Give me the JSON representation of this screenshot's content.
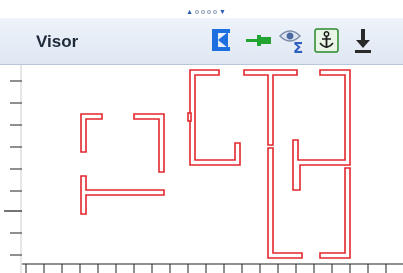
{
  "panel": {
    "title": "Visor"
  },
  "toolbar": {
    "buttons": [
      {
        "icon": "exit-panel-icon",
        "color": "#1c6fe0"
      },
      {
        "icon": "pin-icon",
        "color": "#23a32f"
      },
      {
        "icon": "eye-sigma-icon",
        "color": "#2f5fc0"
      },
      {
        "icon": "anchor-icon",
        "color": "#2b8a2b"
      },
      {
        "icon": "download-icon",
        "color": "#2a2a2a"
      }
    ]
  },
  "colors": {
    "wall": "#e3262b",
    "ruler": "#222222",
    "header_text": "#1e2a3a"
  }
}
